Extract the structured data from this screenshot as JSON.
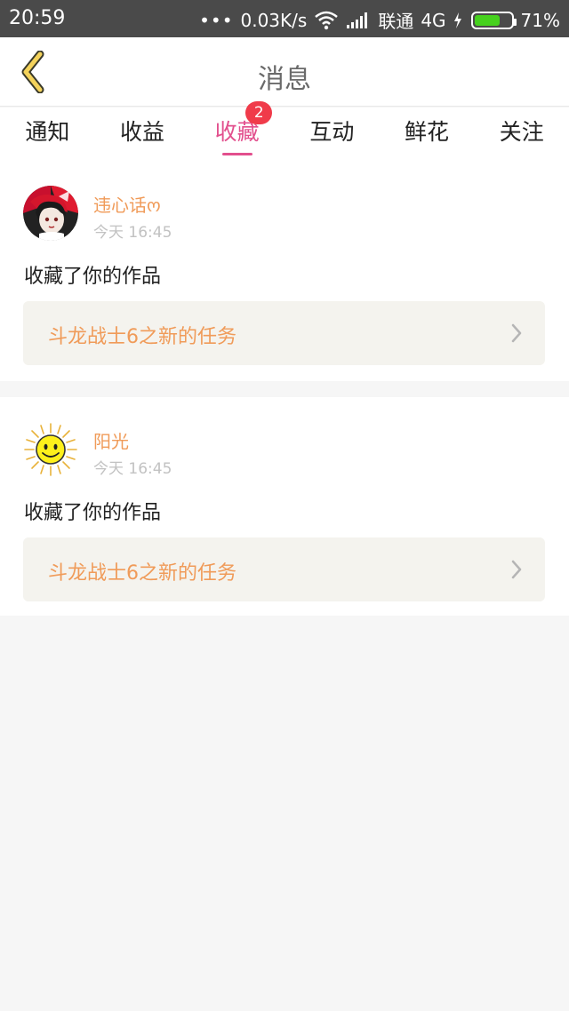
{
  "status_bar": {
    "time": "20:59",
    "dots": "•••",
    "speed": "0.03K/s",
    "carrier": "联通",
    "network": "4G",
    "battery": "71%",
    "battery_level": 0.71,
    "battery_color": "#46d11e"
  },
  "header": {
    "title": "消息",
    "back_icon": "chevron-left-icon"
  },
  "tabs": [
    {
      "label": "通知",
      "active": false
    },
    {
      "label": "收益",
      "active": false
    },
    {
      "label": "收藏",
      "active": true,
      "badge": "2"
    },
    {
      "label": "互动",
      "active": false
    },
    {
      "label": "鲜花",
      "active": false
    },
    {
      "label": "关注",
      "active": false
    }
  ],
  "colors": {
    "accent": "#e24f8d",
    "badge": "#f03b4a",
    "username": "#f09b59",
    "link_bg": "#f4f3ee"
  },
  "messages": [
    {
      "user": "违心话ო",
      "time": "今天 16:45",
      "action": "收藏了你的作品",
      "work_title": "斗龙战士6之新的任务",
      "avatar_icon": "anime-girl-avatar"
    },
    {
      "user": "阳光",
      "time": "今天 16:45",
      "action": "收藏了你的作品",
      "work_title": "斗龙战士6之新的任务",
      "avatar_icon": "sun-avatar"
    }
  ]
}
